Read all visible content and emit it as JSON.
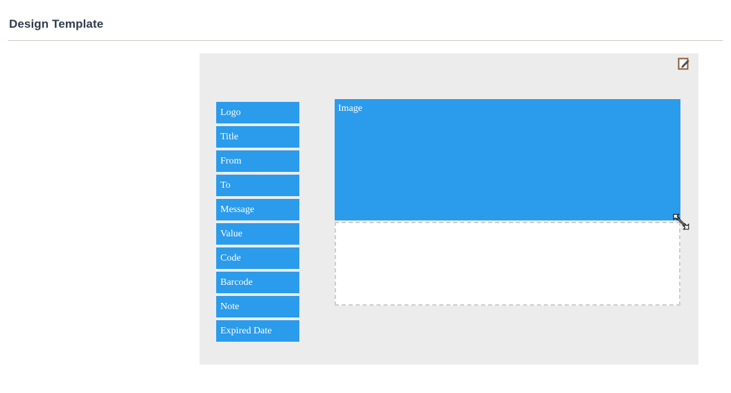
{
  "header": {
    "title": "Design Template"
  },
  "canvas": {
    "edit_icon": "edit-pencil-square-icon",
    "background_color": "#ececec"
  },
  "field_list": {
    "items": [
      {
        "label": "Logo"
      },
      {
        "label": "Title"
      },
      {
        "label": "From"
      },
      {
        "label": "To"
      },
      {
        "label": "Message"
      },
      {
        "label": "Value"
      },
      {
        "label": "Code"
      },
      {
        "label": "Barcode"
      },
      {
        "label": "Note"
      },
      {
        "label": "Expired Date"
      }
    ],
    "chip_color": "#2b9bec",
    "chip_text_color": "#ffffff"
  },
  "preview": {
    "image_block_label": "Image",
    "image_block_color": "#2b9bec",
    "drop_zone_border_color": "#cdcdcd",
    "drop_zone_background": "#ffffff"
  },
  "cursor": {
    "type": "resize-nwse-cursor"
  },
  "colors": {
    "title_text": "#2f3c4c",
    "divider": "#cdc7bd",
    "accent_blue": "#2b9bec",
    "edit_icon": "#8a5b36"
  }
}
